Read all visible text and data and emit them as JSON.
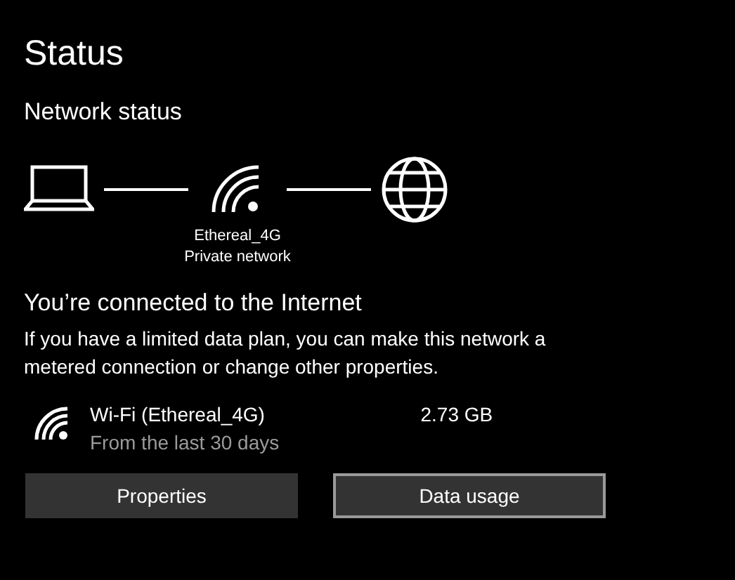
{
  "page": {
    "title": "Status"
  },
  "network_status": {
    "heading": "Network status",
    "network_name": "Ethereal_4G",
    "network_type": "Private network"
  },
  "connection": {
    "heading": "You’re connected to the Internet",
    "description": "If you have a limited data plan, you can make this network a metered connection or change other properties."
  },
  "adapter": {
    "name": "Wi-Fi (Ethereal_4G)",
    "period": "From the last 30 days",
    "usage": "2.73 GB"
  },
  "buttons": [
    {
      "label": "Properties",
      "focused": false
    },
    {
      "label": "Data usage",
      "focused": true
    }
  ]
}
